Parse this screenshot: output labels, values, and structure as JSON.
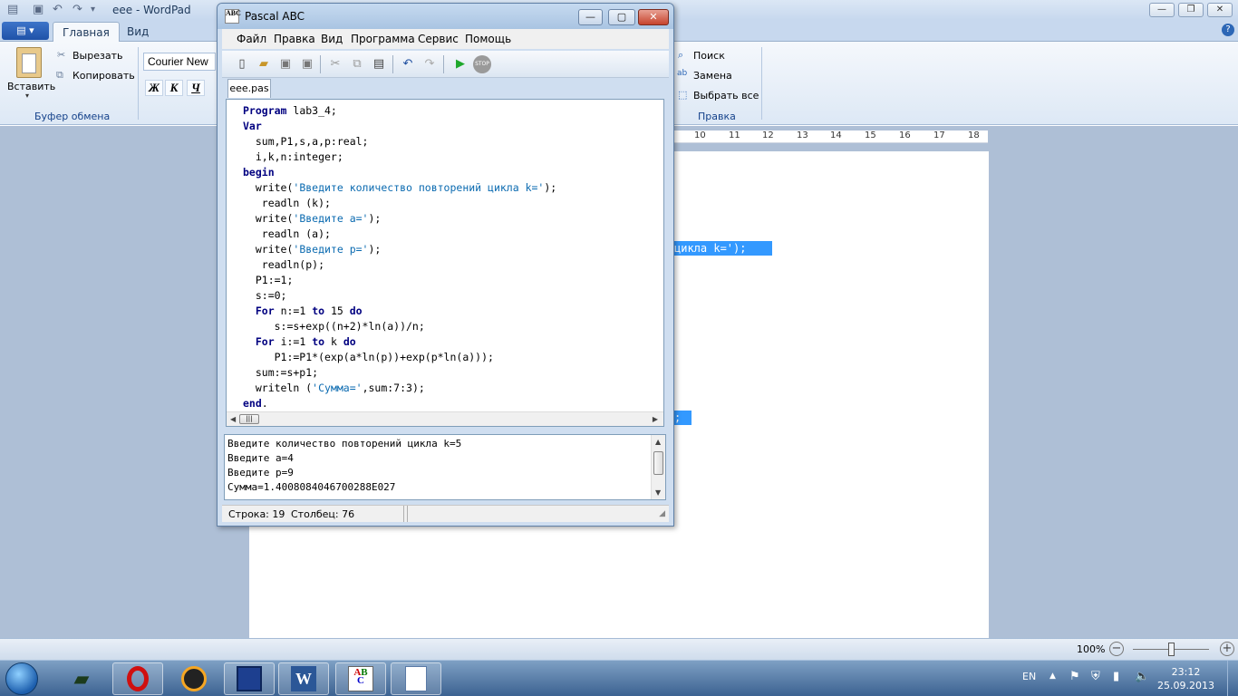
{
  "wordpad": {
    "title": "eee - WordPad",
    "file_menu": "▤ ▾",
    "tabs": [
      "Главная",
      "Вид"
    ],
    "ribbon": {
      "paste": "Вставить",
      "cut": "Вырезать",
      "copy": "Копировать",
      "clipboard_group": "Буфер обмена",
      "font": "Courier New",
      "bold": "Ж",
      "italic": "К",
      "underline": "Ч",
      "find": "Поиск",
      "replace": "Замена",
      "select_all": "Выбрать все",
      "edit_group": "Правка"
    },
    "ruler": [
      "10",
      "11",
      "12",
      "13",
      "14",
      "15",
      "16",
      "17",
      "18"
    ],
    "selected_text_1": "цикла k=');",
    "selected_text_2": ";",
    "zoom": "100%"
  },
  "pascal": {
    "title": "Pascal ABC",
    "logo": "ABC",
    "menu": [
      "Файл",
      "Правка",
      "Вид",
      "Программа",
      "Сервис",
      "Помощь"
    ],
    "tab": "eee.pas",
    "code": [
      [
        {
          "k": "kw",
          "t": "Program"
        },
        {
          "t": " lab3_4;"
        }
      ],
      [
        {
          "k": "kw",
          "t": "Var"
        }
      ],
      [
        {
          "t": "  sum,P1,s,a,p:real;"
        }
      ],
      [
        {
          "t": "  i,k,n:integer;"
        }
      ],
      [
        {
          "k": "kw",
          "t": "begin"
        }
      ],
      [
        {
          "t": "  write("
        },
        {
          "k": "st",
          "t": "'Введите количество повторений цикла k='"
        },
        {
          "t": ");"
        }
      ],
      [
        {
          "t": "   readln (k);"
        }
      ],
      [
        {
          "t": "  write("
        },
        {
          "k": "st",
          "t": "'Введите a='"
        },
        {
          "t": ");"
        }
      ],
      [
        {
          "t": "   readln (a);"
        }
      ],
      [
        {
          "t": "  write("
        },
        {
          "k": "st",
          "t": "'Введите p='"
        },
        {
          "t": ");"
        }
      ],
      [
        {
          "t": "   readln(p);"
        }
      ],
      [
        {
          "t": "  P1:=1;"
        }
      ],
      [
        {
          "t": "  s:=0;"
        }
      ],
      [
        {
          "t": "  "
        },
        {
          "k": "kw",
          "t": "For"
        },
        {
          "t": " n:=1 "
        },
        {
          "k": "kw",
          "t": "to"
        },
        {
          "t": " 15 "
        },
        {
          "k": "kw",
          "t": "do"
        }
      ],
      [
        {
          "t": "     s:=s+exp((n+2)*ln(a))/n;"
        }
      ],
      [
        {
          "t": "  "
        },
        {
          "k": "kw",
          "t": "For"
        },
        {
          "t": " i:=1 "
        },
        {
          "k": "kw",
          "t": "to"
        },
        {
          "t": " k "
        },
        {
          "k": "kw",
          "t": "do"
        }
      ],
      [
        {
          "t": "     P1:=P1*(exp(a*ln(p))+exp(p*ln(a)));"
        }
      ],
      [
        {
          "t": "  sum:=s+p1;"
        }
      ],
      [
        {
          "t": "  writeln ("
        },
        {
          "k": "st",
          "t": "'Сумма='"
        },
        {
          "t": ",sum:7:3);"
        }
      ],
      [
        {
          "k": "kw",
          "t": "end"
        },
        {
          "t": "."
        }
      ]
    ],
    "output": [
      "Введите количество повторений цикла k=5",
      "Введите a=4",
      "Введите p=9",
      "Сумма=1.4008084046700288E027"
    ],
    "status": {
      "line": "Строка: 19",
      "column": "Столбец: 76"
    }
  },
  "taskbar": {
    "lang": "EN",
    "time": "23:12",
    "date": "25.09.2013"
  }
}
